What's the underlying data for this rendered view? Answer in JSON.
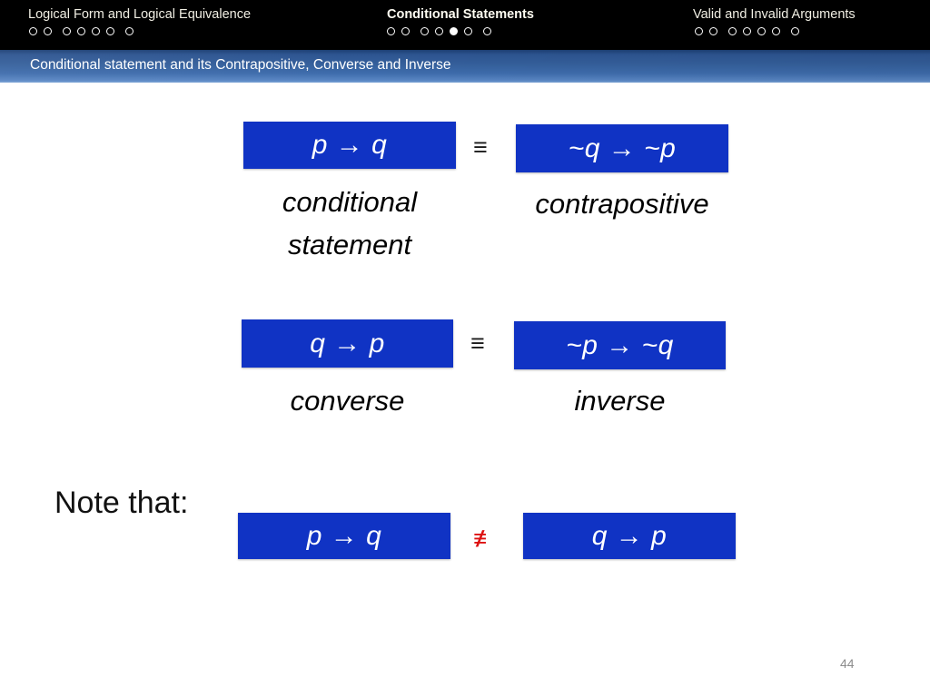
{
  "topnav": {
    "groups": [
      {
        "title": "Logical Form and Logical Equivalence",
        "active": false,
        "dots": [
          false,
          false,
          false,
          false,
          false,
          false,
          false
        ]
      },
      {
        "title": "Conditional Statements",
        "active": true,
        "dots": [
          false,
          false,
          false,
          false,
          true,
          false,
          false
        ]
      },
      {
        "title": "Valid and Invalid Arguments",
        "active": false,
        "dots": [
          false,
          false,
          false,
          false,
          false,
          false,
          false
        ]
      }
    ]
  },
  "subtitle": {
    "text": "Conditional statement and its Contrapositive, Converse and Inverse"
  },
  "slide": {
    "row1": {
      "left_box": "p → q",
      "left_caption": "conditional\nstatement",
      "symbol": "≡",
      "right_box": "~q → ~p",
      "right_caption": "contrapositive"
    },
    "row2": {
      "left_box": "q → p",
      "left_caption": "converse",
      "symbol": "≡",
      "right_box": "~p → ~q",
      "right_caption": "inverse"
    },
    "note": {
      "label": "Note that:",
      "left_box": "p → q",
      "symbol": "≢",
      "right_box": "q → p"
    }
  },
  "page_number": "44",
  "colors": {
    "box_blue": "#1033c4",
    "topbar_black": "#000000",
    "subtitle_blue": "#35609c",
    "not_equiv_red": "#dd1111",
    "page_number_gray": "#8c8c8c"
  }
}
